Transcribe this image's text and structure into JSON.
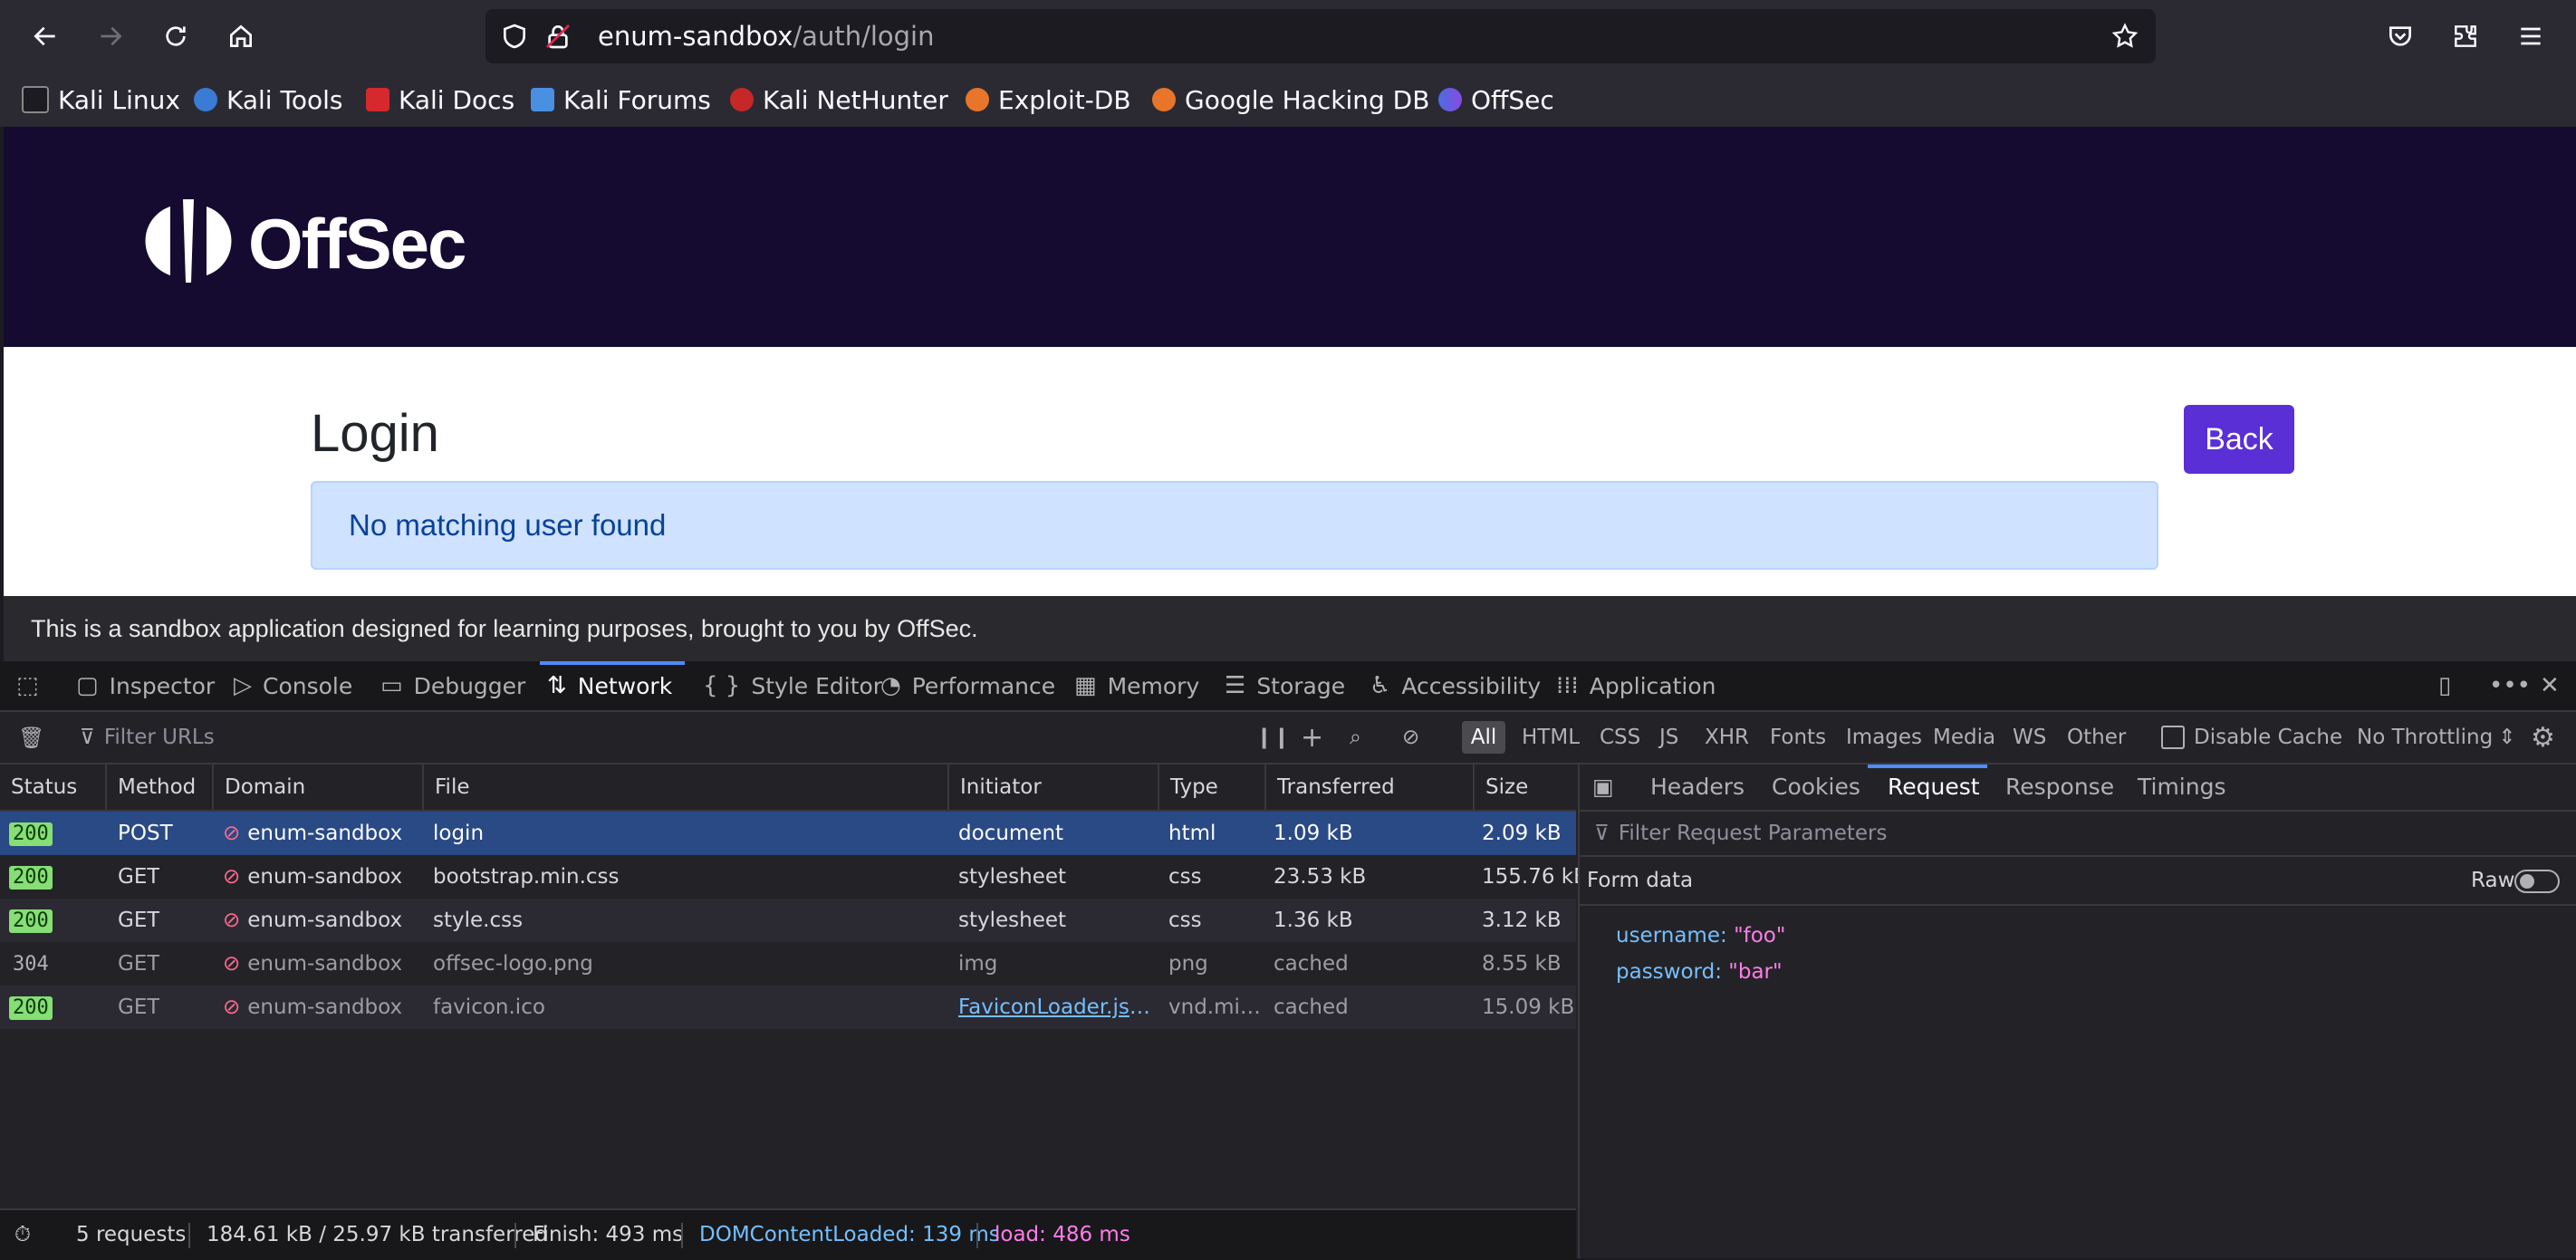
{
  "browser": {
    "url_host": "enum-sandbox",
    "url_path": "/auth/login",
    "bookmarks": [
      "Kali Linux",
      "Kali Tools",
      "Kali Docs",
      "Kali Forums",
      "Kali NetHunter",
      "Exploit-DB",
      "Google Hacking DB",
      "OffSec"
    ]
  },
  "page": {
    "logo_text": "OffSec",
    "title": "Login",
    "back_label": "Back",
    "alert": "No matching user found",
    "footer": "This is a sandbox application designed for learning purposes, brought to you by OffSec."
  },
  "devtools": {
    "tabs": [
      "Inspector",
      "Console",
      "Debugger",
      "Network",
      "Style Editor",
      "Performance",
      "Memory",
      "Storage",
      "Accessibility",
      "Application"
    ],
    "filter_placeholder": "Filter URLs",
    "type_filters": [
      "All",
      "HTML",
      "CSS",
      "JS",
      "XHR",
      "Fonts",
      "Images",
      "Media",
      "WS",
      "Other"
    ],
    "disable_cache": "Disable Cache",
    "throttling": "No Throttling",
    "columns": [
      "Status",
      "Method",
      "Domain",
      "File",
      "Initiator",
      "Type",
      "Transferred",
      "Size"
    ],
    "rows": [
      {
        "status": "200",
        "method": "POST",
        "domain": "enum-sandbox",
        "file": "login",
        "initiator": "document",
        "type": "html",
        "transferred": "1.09 kB",
        "size": "2.09 kB"
      },
      {
        "status": "200",
        "method": "GET",
        "domain": "enum-sandbox",
        "file": "bootstrap.min.css",
        "initiator": "stylesheet",
        "type": "css",
        "transferred": "23.53 kB",
        "size": "155.76 kB"
      },
      {
        "status": "200",
        "method": "GET",
        "domain": "enum-sandbox",
        "file": "style.css",
        "initiator": "stylesheet",
        "type": "css",
        "transferred": "1.36 kB",
        "size": "3.12 kB"
      },
      {
        "status": "304",
        "method": "GET",
        "domain": "enum-sandbox",
        "file": "offsec-logo.png",
        "initiator": "img",
        "type": "png",
        "transferred": "cached",
        "size": "8.55 kB"
      },
      {
        "status": "200",
        "method": "GET",
        "domain": "enum-sandbox",
        "file": "favicon.ico",
        "initiator": "FaviconLoader.jsm:…",
        "type": "vnd.mi…",
        "transferred": "cached",
        "size": "15.09 kB"
      }
    ],
    "side_tabs": [
      "Headers",
      "Cookies",
      "Request",
      "Response",
      "Timings"
    ],
    "side_filter_placeholder": "Filter Request Parameters",
    "form_data_label": "Form data",
    "raw_label": "Raw",
    "form_data": [
      {
        "key": "username:",
        "value": "\"foo\""
      },
      {
        "key": "password:",
        "value": "\"bar\""
      }
    ],
    "statusbar": {
      "requests": "5 requests",
      "size": "184.61 kB / 25.97 kB transferred",
      "finish": "Finish: 493 ms",
      "domcontentloaded": "DOMContentLoaded: 139 ms",
      "load": "load: 486 ms"
    }
  },
  "colors": {
    "hero_bg": "#150a30",
    "accent": "#5a2fd6",
    "alert_bg": "#cfe2ff",
    "selected_row": "#2a4a85"
  }
}
